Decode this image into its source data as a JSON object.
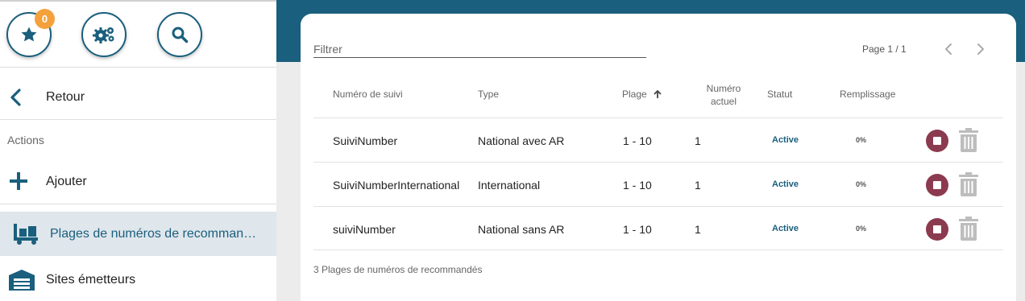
{
  "toolbar": {
    "favorites_badge": "0"
  },
  "sidebar": {
    "back_label": "Retour",
    "actions_title": "Actions",
    "add_label": "Ajouter",
    "items": [
      {
        "label": "Plages de numéros de recommandés",
        "active": true
      },
      {
        "label": "Sites émetteurs",
        "active": false
      }
    ]
  },
  "main": {
    "filter_placeholder": "Filtrer",
    "pagination": "Page 1 / 1",
    "columns": {
      "numero_suivi": "Numéro de suivi",
      "type": "Type",
      "plage": "Plage",
      "numero_actuel_1": "Numéro",
      "numero_actuel_2": "actuel",
      "statut": "Statut",
      "remplissage": "Remplissage"
    },
    "rows": [
      {
        "numero": "SuiviNumber",
        "type": "National avec AR",
        "plage": "1 - 10",
        "actuel": "1",
        "statut": "Active",
        "remplissage": "0%"
      },
      {
        "numero": "SuiviNumberInternational",
        "type": "International",
        "plage": "1 - 10",
        "actuel": "1",
        "statut": "Active",
        "remplissage": "0%"
      },
      {
        "numero": "suiviNumber",
        "type": "National sans AR",
        "plage": "1 - 10",
        "actuel": "1",
        "statut": "Active",
        "remplissage": "0%"
      }
    ],
    "footer": "3 Plages de numéros de recommandés"
  },
  "colors": {
    "primary": "#1a5f7d",
    "badge": "#f4a13c",
    "stop": "#8c3a4f",
    "active_nav_bg": "#dfe6ec"
  }
}
